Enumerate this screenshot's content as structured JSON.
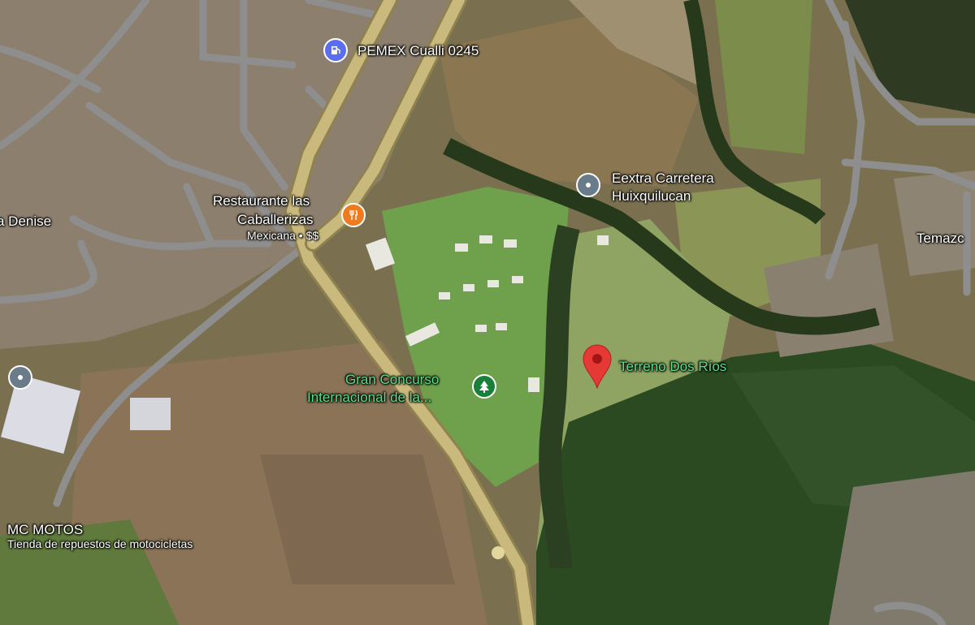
{
  "map": {
    "view": "satellite",
    "colors": {
      "road": "#c9b97d",
      "road_outline": "#8f8150",
      "street": "#8e8e8e",
      "pin_red": "#e53935",
      "food_orange": "#f07b1f",
      "gas_blue": "#5b6ef0",
      "park_green": "#188038",
      "generic_gray": "#6a7b8a"
    },
    "places": {
      "pemex": {
        "name": "PEMEX Cualli 0245",
        "icon": "gas-station-icon"
      },
      "restaurant": {
        "name_line1": "Restaurante las",
        "name_line2": "Caballerizas",
        "subtitle": "Mexicana • $$",
        "icon": "restaurant-icon"
      },
      "eextra": {
        "name_line1": "Eextra Carretera",
        "name_line2": "Huixquilucan",
        "icon": "place-icon"
      },
      "gran_concurso": {
        "name_line1": "Gran Concurso",
        "name_line2": "Internacional de la...",
        "icon": "park-tree-icon"
      },
      "terreno": {
        "name": "Terreno Dos Ríos",
        "icon": "map-pin-icon"
      },
      "mc_motos": {
        "name": "MC MOTOS",
        "subtitle": "Tienda de repuestos de motocicletas"
      },
      "denise": {
        "name": "a Denise"
      },
      "temazc": {
        "name": "Temazc"
      },
      "left_poi": {
        "icon": "place-icon"
      }
    }
  }
}
